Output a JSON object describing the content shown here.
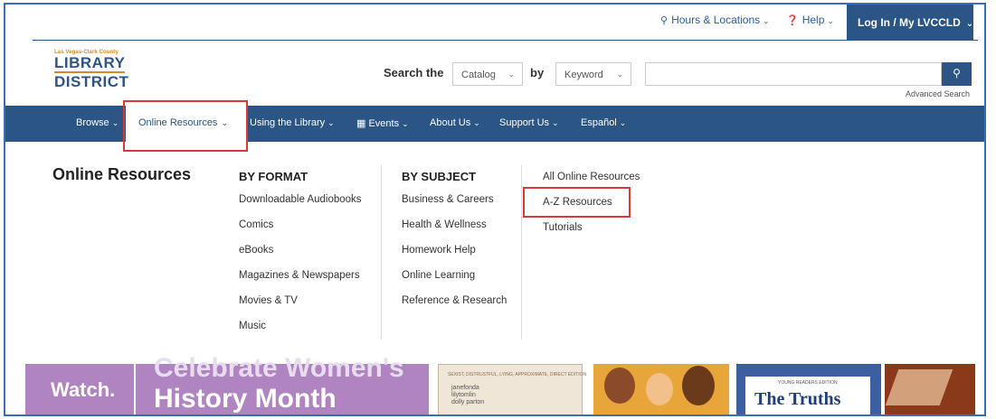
{
  "utility": {
    "hours": "Hours & Locations",
    "help": "Help",
    "login": "Log In / My LVCCLD"
  },
  "logo": {
    "top": "Las Vegas-Clark County",
    "line1": "LIBRARY",
    "line2": "DISTRICT"
  },
  "search": {
    "label_the": "Search the",
    "catalog": "Catalog",
    "label_by": "by",
    "keyword": "Keyword",
    "advanced": "Advanced Search"
  },
  "nav": {
    "browse": "Browse",
    "online_resources": "Online Resources",
    "using": "Using the Library",
    "events": "Events",
    "about": "About Us",
    "support": "Support Us",
    "espanol": "Español"
  },
  "menu": {
    "title": "Online Resources",
    "by_format": {
      "heading": "BY FORMAT",
      "items": [
        "Downloadable Audiobooks",
        "Comics",
        "eBooks",
        "Magazines & Newspapers",
        "Movies & TV",
        "Music"
      ]
    },
    "by_subject": {
      "heading": "BY SUBJECT",
      "items": [
        "Business & Careers",
        "Health & Wellness",
        "Homework Help",
        "Online Learning",
        "Reference & Research"
      ]
    },
    "other": {
      "items": [
        "All Online Resources",
        "A-Z Resources",
        "Tutorials"
      ]
    }
  },
  "banner": {
    "line1a": "Watch.",
    "line2a": "History Month",
    "line1b": "Celebrate Women's",
    "book1_small": "SEXIST, DISTRUSTFUL, LYING, APPROXIMATE, DIRECT EDITION",
    "book1_names": "janefonda\nlilytomlin\ndolly parton",
    "book2_small": "YOUNG READERS EDITION",
    "book2_title": "The Truths"
  },
  "colors": {
    "brand_blue": "#2a5585",
    "highlight_red": "#d63a3a",
    "logo_orange": "#d28a2c"
  }
}
